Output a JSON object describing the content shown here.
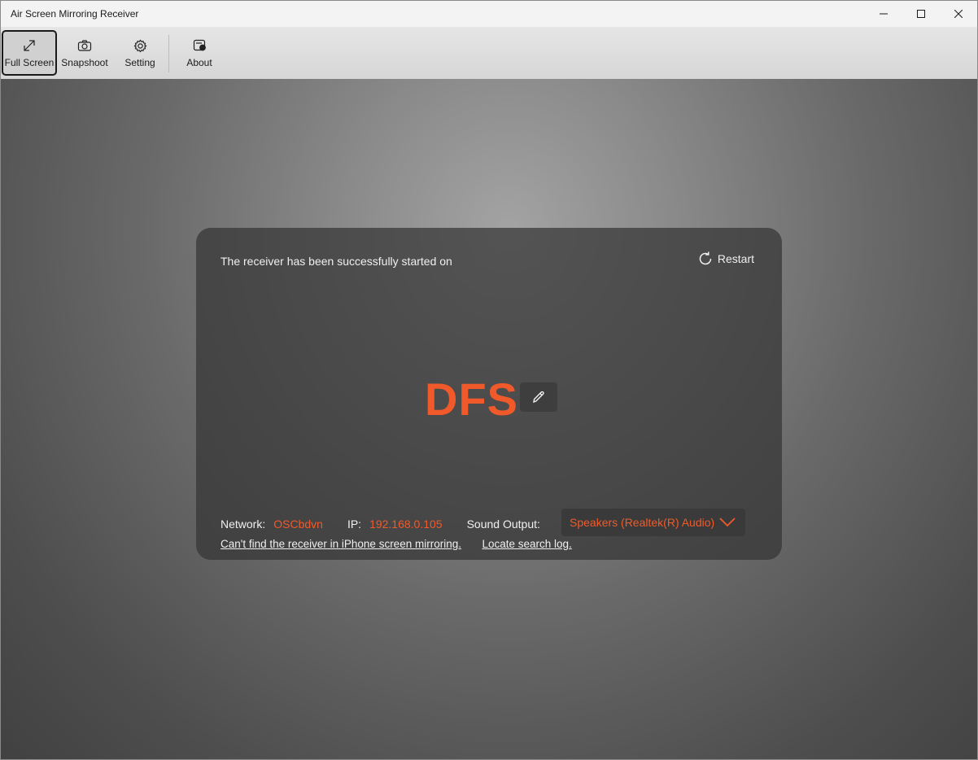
{
  "window": {
    "title": "Air Screen Mirroring Receiver",
    "controls": [
      "minimize-icon",
      "maximize-icon",
      "close-icon"
    ]
  },
  "toolbar": {
    "full_screen": "Full Screen",
    "snapshoot": "Snapshoot",
    "setting": "Setting",
    "about": "About",
    "active": "Full Screen"
  },
  "card": {
    "status": "The receiver has been successfully started on",
    "restart": "Restart",
    "receiver_name": "DFS",
    "network_label": "Network:",
    "network_value": "OSCbdvn",
    "ip_label": "IP:",
    "ip_value": "192.168.0.105",
    "sound_label": "Sound Output:",
    "sound_value": "Speakers (Realtek(R) Audio)",
    "help_link": "Can't find the receiver in iPhone screen mirroring.",
    "log_link": "Locate search log."
  },
  "colors": {
    "accent": "#f05a2a",
    "card_bg": "#343434",
    "toolbar_bg": "#dcdcdc"
  }
}
